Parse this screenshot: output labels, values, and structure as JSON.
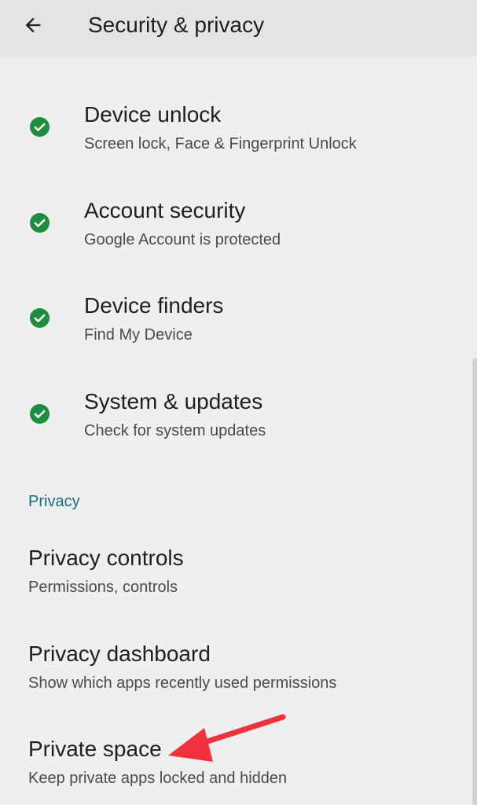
{
  "header": {
    "title": "Security & privacy",
    "back_icon": "arrow-left-icon"
  },
  "status_items": [
    {
      "title": "Device unlock",
      "subtitle": "Screen lock, Face & Fingerprint Unlock",
      "icon": "check-circle-icon",
      "status_color": "#1e8e3e"
    },
    {
      "title": "Account security",
      "subtitle": "Google Account is protected",
      "icon": "check-circle-icon",
      "status_color": "#1e8e3e"
    },
    {
      "title": "Device finders",
      "subtitle": "Find My Device",
      "icon": "check-circle-icon",
      "status_color": "#1e8e3e"
    },
    {
      "title": "System & updates",
      "subtitle": "Check for system updates",
      "icon": "check-circle-icon",
      "status_color": "#1e8e3e"
    }
  ],
  "privacy_section": {
    "header": "Privacy",
    "header_color": "#126c8c",
    "items": [
      {
        "title": "Privacy controls",
        "subtitle": "Permissions, controls"
      },
      {
        "title": "Privacy dashboard",
        "subtitle": "Show which apps recently used permissions"
      },
      {
        "title": "Private space",
        "subtitle": "Keep private apps locked and hidden"
      }
    ]
  },
  "annotation": {
    "arrow_color": "#f0323c"
  }
}
